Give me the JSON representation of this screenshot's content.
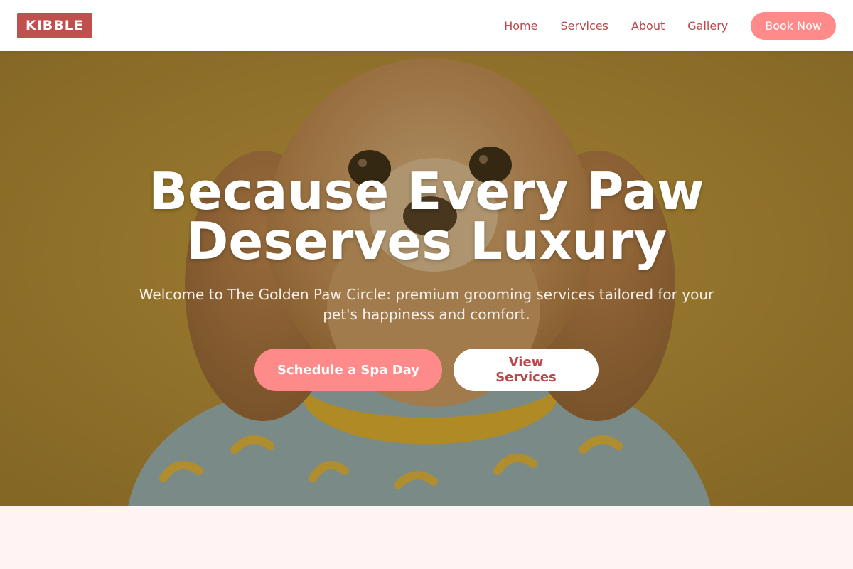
{
  "brand": {
    "logo_text": "KIBBLE"
  },
  "nav": {
    "links": [
      "Home",
      "Services",
      "About",
      "Gallery"
    ],
    "cta_label": "Book Now"
  },
  "hero": {
    "title_line1": "Because Every Paw",
    "title_line2": "Deserves Luxury",
    "subtitle": "Welcome to The Golden Paw Circle: premium grooming services tailored for your pet's happiness and comfort.",
    "primary_button": "Schedule a Spa Day",
    "secondary_button": "View Services",
    "image": "puppy in banana-print shirt on mustard background"
  },
  "colors": {
    "brand_red": "#c0504d",
    "accent_pink": "#ff8a8a",
    "link_red": "#b9474b",
    "hero_background": "#9e7d35",
    "section_background": "#fff4f3"
  }
}
